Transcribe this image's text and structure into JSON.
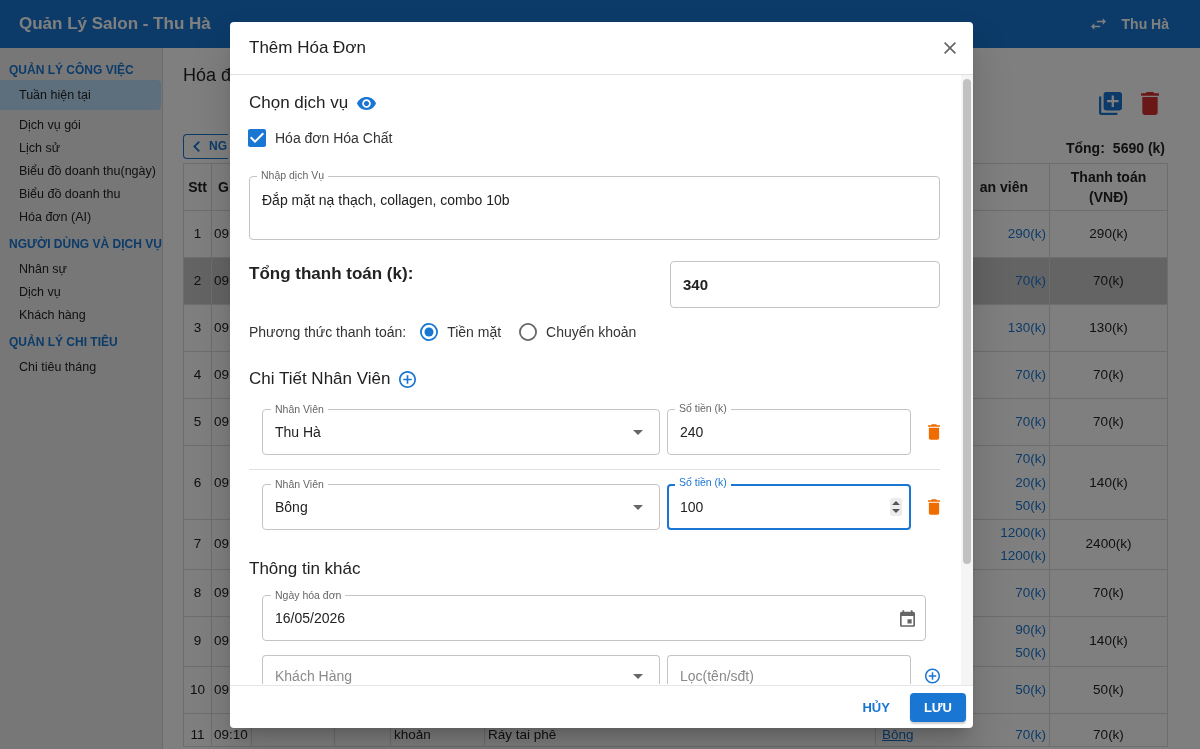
{
  "app_bar": {
    "title": "Quản Lý Salon - Thu Hà",
    "user": "Thu Hà"
  },
  "sidebar": {
    "sections": [
      {
        "title": "QUẢN LÝ CÔNG VIỆC",
        "items": [
          {
            "label": "Tuần hiện tại",
            "selected": true
          },
          {
            "label": "Dịch vụ gói",
            "selected": false
          },
          {
            "label": "Lịch sử",
            "selected": false
          },
          {
            "label": "Biểu đồ doanh thu(ngày)",
            "selected": false
          },
          {
            "label": "Biểu đồ doanh thu",
            "selected": false
          },
          {
            "label": "Hóa đơn (AI)",
            "selected": false
          }
        ]
      },
      {
        "title": "NGƯỜI DÙNG VÀ DỊCH VỤ",
        "items": [
          {
            "label": "Nhân sự",
            "selected": false
          },
          {
            "label": "Dịch vụ",
            "selected": false
          },
          {
            "label": "Khách hàng",
            "selected": false
          }
        ]
      },
      {
        "title": "QUẢN LÝ CHI TIÊU",
        "items": [
          {
            "label": "Chi tiêu tháng",
            "selected": false
          }
        ]
      }
    ]
  },
  "page": {
    "title": "Hóa đ",
    "prev_button": "NG",
    "total_label": "Tổng:",
    "total_value": "5690 (k)",
    "table": {
      "header": {
        "column_1": "Stt",
        "column_2": "G",
        "column_7": "an viên",
        "column_8": "Thanh toán (VNĐ)"
      },
      "rows": [
        {
          "column_1": "1",
          "column_2": "09",
          "amounts": [
            "290(k)"
          ],
          "column_8": "290(k)",
          "selected": false
        },
        {
          "column_1": "2",
          "column_2": "09",
          "amounts": [
            "70(k)"
          ],
          "column_8": "70(k)",
          "selected": true
        },
        {
          "column_1": "3",
          "column_2": "09",
          "amounts": [
            "130(k)"
          ],
          "column_8": "130(k)",
          "selected": false
        },
        {
          "column_1": "4",
          "column_2": "09",
          "amounts": [
            "70(k)"
          ],
          "column_8": "70(k)",
          "selected": false
        },
        {
          "column_1": "5",
          "column_2": "09",
          "amounts": [
            "70(k)"
          ],
          "column_8": "70(k)",
          "selected": false
        },
        {
          "column_1": "6",
          "column_2": "09",
          "amounts": [
            "70(k)",
            "20(k)",
            "50(k)"
          ],
          "column_8": "140(k)",
          "selected": false
        },
        {
          "column_1": "7",
          "column_2": "09",
          "amounts": [
            "1200(k)",
            "1200(k)"
          ],
          "column_8": "2400(k)",
          "selected": false
        },
        {
          "column_1": "8",
          "column_2": "09",
          "amounts": [
            "70(k)"
          ],
          "column_8": "70(k)",
          "selected": false
        },
        {
          "column_1": "9",
          "column_2": "09",
          "amounts": [
            "90(k)",
            "50(k)"
          ],
          "column_8": "140(k)",
          "selected": false
        },
        {
          "column_1": "10",
          "column_2": "09",
          "amounts": [
            "50(k)"
          ],
          "column_8": "50(k)",
          "selected": false
        },
        {
          "column_1": "11",
          "column_2": "09:10",
          "column_5": "khoản",
          "column_6": "Ráy tai phê",
          "staff": "Bông",
          "amounts": [
            "70(k)"
          ],
          "column_8": "70(k)",
          "selected": false
        }
      ]
    }
  },
  "dialog": {
    "title": "Thêm Hóa Đơn",
    "service_section": {
      "heading": "Chọn dịch vụ",
      "chemical_invoice": {
        "label": "Hóa đơn Hóa Chất",
        "checked": true
      },
      "service_field": {
        "label": "Nhập dịch Vụ",
        "value": "Đắp mặt nạ thạch, collagen, combo 10b"
      }
    },
    "total": {
      "label": "Tổng thanh toán (k):",
      "value": "340"
    },
    "payment_method": {
      "label": "Phương thức thanh toán:",
      "options": [
        {
          "label": "Tiền mặt",
          "selected": true
        },
        {
          "label": "Chuyển khoản",
          "selected": false
        }
      ]
    },
    "staff_section": {
      "heading": "Chi Tiết Nhân Viên",
      "rows": [
        {
          "staff_label": "Nhân Viên",
          "staff": "Thu Hà",
          "amount_label": "Số tiền (k)",
          "amount": "240",
          "focused": false
        },
        {
          "staff_label": "Nhân Viên",
          "staff": "Bông",
          "amount_label": "Số tiền (k)",
          "amount": "100",
          "focused": true
        }
      ]
    },
    "other_section": {
      "heading": "Thông tin khác",
      "date_field": {
        "label": "Ngày hóa đơn",
        "value": "16/05/2026"
      },
      "customer_field": {
        "label": "Khách Hàng"
      },
      "filter_field": {
        "placeholder": "Lọc(tên/sđt)"
      }
    },
    "buttons": [
      {
        "label": "HỦY",
        "kind": "text"
      },
      {
        "label": "LƯU",
        "kind": "contained"
      }
    ]
  }
}
